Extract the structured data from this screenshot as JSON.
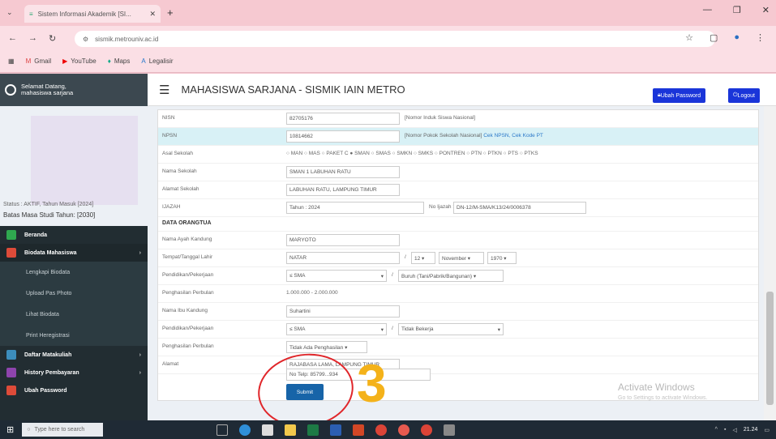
{
  "browser": {
    "tab_title": "Sistem Informasi Akademik [SI...",
    "url": "sismik.metrouniv.ac.id",
    "bookmarks": [
      "Gmail",
      "YouTube",
      "Maps",
      "Legalisir"
    ]
  },
  "sidebar": {
    "welcome": "Selamat Datang, mahasiswa sarjana",
    "status": "Status : AKTIF, Tahun Masuk [2024]",
    "masa_studi": "Batas Masa Studi Tahun: [2030]",
    "menu": [
      {
        "label": "Beranda",
        "color": "#2fa84f"
      },
      {
        "label": "Biodata Mahasiswa",
        "color": "#dd4b39"
      }
    ],
    "submenu": [
      "Lengkapi Biodata",
      "Upload Pas Photo",
      "Lihat Biodata",
      "Print Heregistrasi"
    ],
    "menu2": [
      {
        "label": "Daftar Matakuliah",
        "color": "#3c8dbc"
      },
      {
        "label": "History Pembayaran",
        "color": "#8e44ad"
      },
      {
        "label": "Ubah Password",
        "color": "#dd4b39"
      }
    ]
  },
  "header": {
    "title": "MAHASISWA SARJANA - SISMIK IAIN METRO",
    "ubah_password": "Ubah Password",
    "logout": "Logout"
  },
  "form": {
    "nisn_label": "NISN",
    "nisn_value": "82705176",
    "nisn_note": "[Nomor Induk Siswa Nasional]",
    "npsn_label": "NPSN",
    "npsn_value": "10814662",
    "npsn_note": "[Nomor Pokok Sekolah Nasional]",
    "npsn_link1": "Cek NPSN,",
    "npsn_link2": "Cek Kode PT",
    "asal_label": "Asal Sekolah",
    "asal_options": "MAN ○ MAS ○ PAKET C ● SMAN ○ SMAS ○ SMKN ○ SMKS ○ PONTREN ○ PTN ○ PTKN ○ PTS ○ PTKS",
    "nama_sekolah_label": "Nama Sekolah",
    "nama_sekolah_value": "SMAN 1 LABUHAN RATU",
    "alamat_sekolah_label": "Alamat Sekolah",
    "alamat_sekolah_value": "LABUHAN RATU, LAMPUNG TIMUR",
    "ijazah_label": "IJAZAH",
    "ijazah_tahun": "Tahun : 2024",
    "ijazah_no_label": "No Ijazah :",
    "ijazah_no_value": "DN-12/M-SMA/K13/24/0006378",
    "ortu_title": "DATA ORANGTUA",
    "ayah_label": "Nama Ayah Kandung",
    "ayah_value": "MARYOTO",
    "ttl_label": "Tempat/Tanggal Lahir",
    "ttl_tempat": "NATAR",
    "ttl_tgl": "12",
    "ttl_bulan": "November",
    "ttl_tahun": "1970",
    "pendidikan_label": "Pendidikan/Pekerjaan",
    "pendidikan_ayah": "≤ SMA",
    "pekerjaan_ayah": "Buruh (Tani/Pabrik/Bangunan)",
    "penghasilan_label": "Penghasilan Perbulan",
    "penghasilan_ayah": "1.000.000 - 2.000.000",
    "ibu_label": "Nama Ibu Kandung",
    "ibu_value": "Suhartini",
    "pendidikan_ibu": "≤ SMA",
    "pekerjaan_ibu": "Tidak Bekerja",
    "penghasilan_ibu": "Tidak Ada Penghasilan",
    "alamat_label": "Alamat",
    "alamat_value": "RAJABASA LAMA, LAMPUNG TIMUR",
    "telp_label": "No Telp:",
    "telp_value": "85799...934",
    "submit": "Submit"
  },
  "annotation": "3",
  "watermark": {
    "line1": "Activate Windows",
    "line2": "Go to Settings to activate Windows."
  },
  "taskbar": {
    "search": "Type here to search",
    "time": "21.24"
  }
}
